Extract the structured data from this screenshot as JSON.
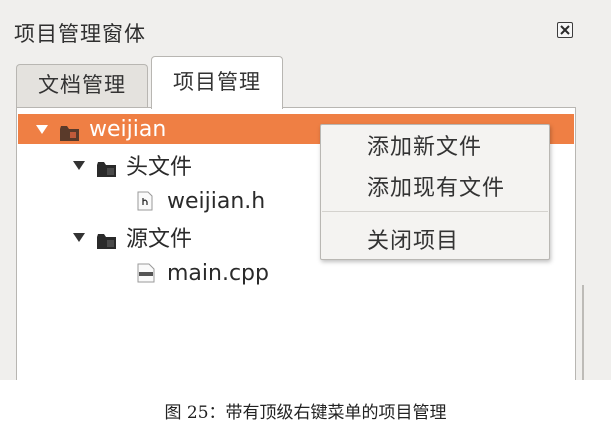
{
  "panel": {
    "title": "项目管理窗体",
    "close_icon": "close-x-icon"
  },
  "tabs": [
    {
      "label": "文档管理",
      "active": false
    },
    {
      "label": "项目管理",
      "active": true
    }
  ],
  "tree": {
    "project": {
      "label": "weijian",
      "icon": "project-folder-icon",
      "expanded": true,
      "selected": true
    },
    "headers": {
      "label": "头文件",
      "icon": "header-folder-icon",
      "expanded": true
    },
    "header_file": {
      "label": "weijian.h",
      "icon": "header-file-icon"
    },
    "sources": {
      "label": "源文件",
      "icon": "source-folder-icon",
      "expanded": true
    },
    "source_file": {
      "label": "main.cpp",
      "icon": "cpp-file-icon"
    }
  },
  "context_menu": {
    "items": [
      {
        "label": "添加新文件"
      },
      {
        "label": "添加现有文件"
      },
      {
        "label": "关闭项目"
      }
    ]
  },
  "caption": "图 25：带有顶级右键菜单的项目管理",
  "colors": {
    "selection": "#ef7f44",
    "panel_bg": "#f0efed",
    "menu_bg": "#f4f3f1"
  }
}
